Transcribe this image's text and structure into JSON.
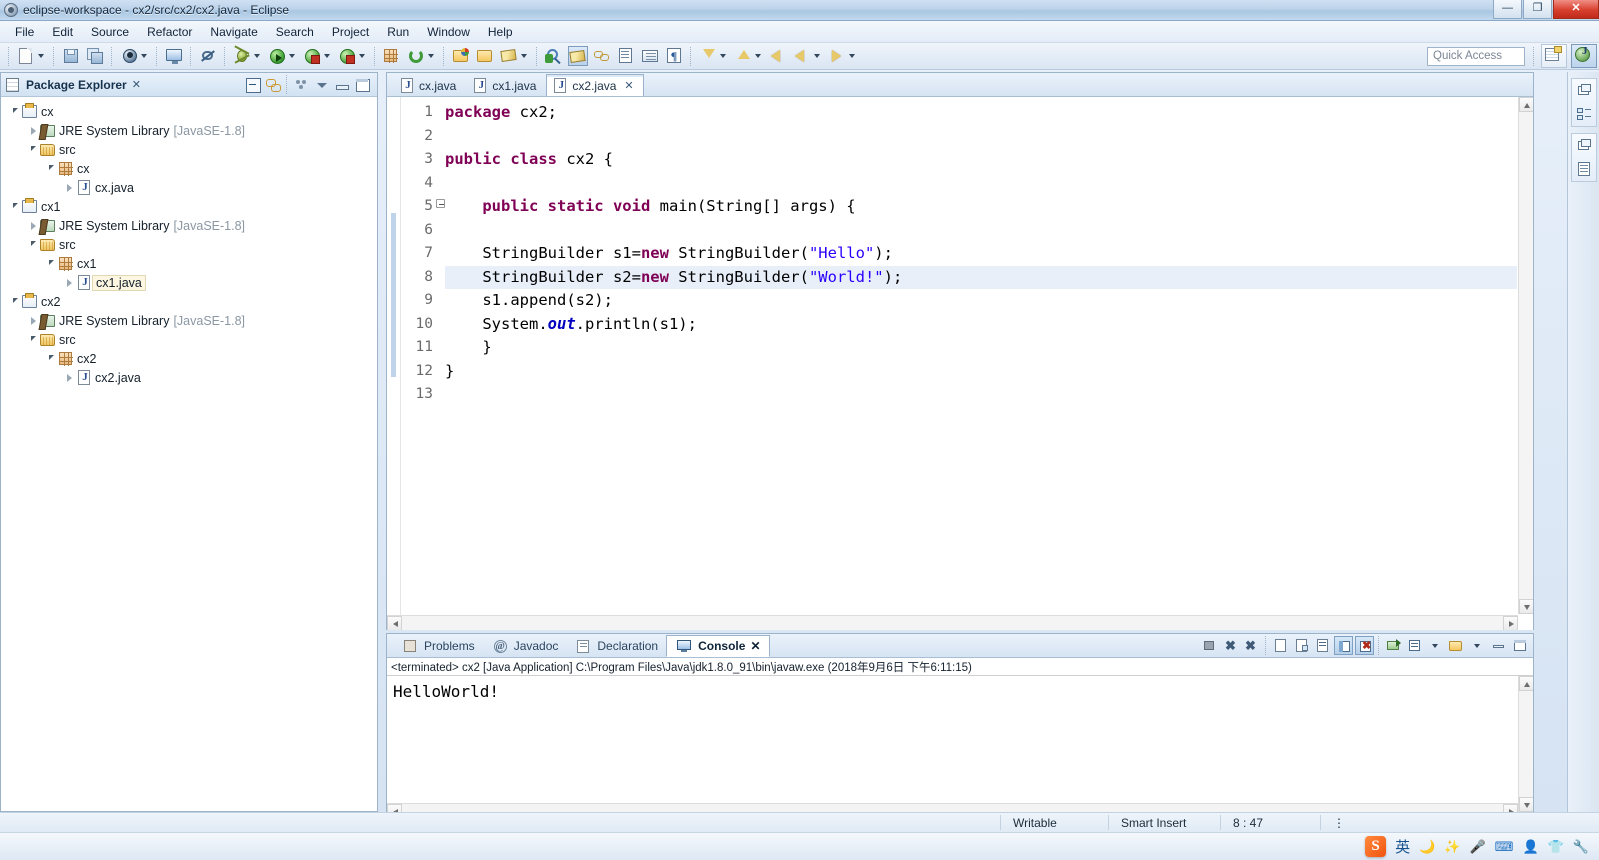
{
  "window": {
    "title": "eclipse-workspace - cx2/src/cx2/cx2.java - Eclipse",
    "minimize": "—",
    "maximize": "❐",
    "close": "✕"
  },
  "menubar": {
    "items": [
      "File",
      "Edit",
      "Source",
      "Refactor",
      "Navigate",
      "Search",
      "Project",
      "Run",
      "Window",
      "Help"
    ]
  },
  "toolbar": {
    "quick_access_placeholder": "Quick Access",
    "icons": [
      "new-wizard-icon",
      "new-dropdown-icon",
      "save-icon",
      "save-all-icon",
      "new-java-class-icon",
      "new-java-class-dropdown-icon",
      "open-type-icon",
      "skip-breakpoints-icon",
      "debug-icon",
      "debug-dropdown-icon",
      "run-icon",
      "run-dropdown-icon",
      "run-coverage-icon",
      "run-coverage-dropdown-icon",
      "external-tools-icon",
      "external-tools-dropdown-icon",
      "new-package-icon",
      "refresh-icon",
      "refresh-dropdown-icon",
      "open-perspective-icon",
      "search-icon",
      "annotations-icon",
      "pencil-icon",
      "pencil-dropdown-icon",
      "java-search-icon",
      "toggle-mark-occurrences-icon",
      "link-icon",
      "next-annotation-icon",
      "show-whitespace-icon",
      "pilcrow-icon",
      "previous-edit-icon",
      "previous-edit-dropdown-icon",
      "next-edit-icon",
      "next-edit-dropdown-icon",
      "back-icon",
      "forward-icon",
      "forward-dropdown-icon",
      "next-icon"
    ],
    "perspective_buttons": [
      "open-perspective-icon",
      "java-perspective-icon"
    ]
  },
  "explorer": {
    "title": "Package Explorer",
    "close_glyph": "✕",
    "tools": [
      "collapse-all-icon",
      "link-with-editor-icon",
      "view-menu-icon",
      "minimize-icon",
      "maximize-icon"
    ],
    "tree": [
      {
        "label": "cx",
        "icon": "project-icon",
        "indent": 0,
        "twist": "open",
        "dim": ""
      },
      {
        "label": "JRE System Library",
        "icon": "jre-library-icon",
        "indent": 1,
        "twist": "closed",
        "dim": "[JavaSE-1.8]"
      },
      {
        "label": "src",
        "icon": "source-folder-icon",
        "indent": 1,
        "twist": "open",
        "dim": ""
      },
      {
        "label": "cx",
        "icon": "package-icon",
        "indent": 2,
        "twist": "open",
        "dim": ""
      },
      {
        "label": "cx.java",
        "icon": "java-file-icon",
        "indent": 3,
        "twist": "closed",
        "dim": ""
      },
      {
        "label": "cx1",
        "icon": "project-icon",
        "indent": 0,
        "twist": "open",
        "dim": ""
      },
      {
        "label": "JRE System Library",
        "icon": "jre-library-icon",
        "indent": 1,
        "twist": "closed",
        "dim": "[JavaSE-1.8]"
      },
      {
        "label": "src",
        "icon": "source-folder-icon",
        "indent": 1,
        "twist": "open",
        "dim": ""
      },
      {
        "label": "cx1",
        "icon": "package-icon",
        "indent": 2,
        "twist": "open",
        "dim": ""
      },
      {
        "label": "cx1.java",
        "icon": "java-file-icon",
        "indent": 3,
        "twist": "closed",
        "dim": "",
        "selected": true
      },
      {
        "label": "cx2",
        "icon": "project-icon",
        "indent": 0,
        "twist": "open",
        "dim": ""
      },
      {
        "label": "JRE System Library",
        "icon": "jre-library-icon",
        "indent": 1,
        "twist": "closed",
        "dim": "[JavaSE-1.8]"
      },
      {
        "label": "src",
        "icon": "source-folder-icon",
        "indent": 1,
        "twist": "open",
        "dim": ""
      },
      {
        "label": "cx2",
        "icon": "package-icon",
        "indent": 2,
        "twist": "open",
        "dim": ""
      },
      {
        "label": "cx2.java",
        "icon": "java-file-icon",
        "indent": 3,
        "twist": "closed",
        "dim": ""
      }
    ]
  },
  "editor": {
    "tabs": [
      {
        "label": "cx.java",
        "active": false,
        "close": ""
      },
      {
        "label": "cx1.java",
        "active": false,
        "close": ""
      },
      {
        "label": "cx2.java",
        "active": true,
        "close": "✕"
      }
    ],
    "line_numbers": [
      "1",
      "2",
      "3",
      "4",
      "5",
      "6",
      "7",
      "8",
      "9",
      "10",
      "11",
      "12",
      "13"
    ],
    "highlighted_line": 8,
    "fold_line": 5,
    "lines": [
      [
        {
          "t": "package",
          "c": "kw"
        },
        {
          "t": " cx2;",
          "c": ""
        }
      ],
      [
        {
          "t": "",
          "c": ""
        }
      ],
      [
        {
          "t": "public class",
          "c": "kw"
        },
        {
          "t": " cx2 {",
          "c": ""
        }
      ],
      [
        {
          "t": "",
          "c": ""
        }
      ],
      [
        {
          "t": "    ",
          "c": ""
        },
        {
          "t": "public static void",
          "c": "kw"
        },
        {
          "t": " main(String[] args) {",
          "c": ""
        }
      ],
      [
        {
          "t": "",
          "c": ""
        }
      ],
      [
        {
          "t": "    StringBuilder s1=",
          "c": ""
        },
        {
          "t": "new",
          "c": "kw"
        },
        {
          "t": " StringBuilder(",
          "c": ""
        },
        {
          "t": "\"Hello\"",
          "c": "str"
        },
        {
          "t": ");",
          "c": ""
        }
      ],
      [
        {
          "t": "    StringBuilder s2=",
          "c": ""
        },
        {
          "t": "new",
          "c": "kw"
        },
        {
          "t": " StringBuilder(",
          "c": ""
        },
        {
          "t": "\"World!\"",
          "c": "str"
        },
        {
          "t": ");",
          "c": ""
        }
      ],
      [
        {
          "t": "    s1.append(s2);",
          "c": ""
        }
      ],
      [
        {
          "t": "    System.",
          "c": ""
        },
        {
          "t": "out",
          "c": "sfield"
        },
        {
          "t": ".println(s1);",
          "c": ""
        }
      ],
      [
        {
          "t": "    }",
          "c": ""
        }
      ],
      [
        {
          "t": "}",
          "c": ""
        }
      ],
      [
        {
          "t": "",
          "c": ""
        }
      ]
    ]
  },
  "console": {
    "tabs": [
      {
        "label": "Problems",
        "icon": "problems-icon",
        "active": false,
        "close": ""
      },
      {
        "label": "Javadoc",
        "icon": "javadoc-icon",
        "active": false,
        "close": ""
      },
      {
        "label": "Declaration",
        "icon": "declaration-icon",
        "active": false,
        "close": ""
      },
      {
        "label": "Console",
        "icon": "console-icon",
        "active": true,
        "close": "✕"
      }
    ],
    "tools": [
      "terminate-icon",
      "remove-launch-icon",
      "remove-all-terminated-icon",
      "clear-console-icon",
      "scroll-lock-icon",
      "word-wrap-icon",
      "show-console-on-output-icon",
      "pin-console-icon",
      "display-selected-console-icon",
      "open-console-icon",
      "open-console-dropdown-icon",
      "view-menu-icon",
      "minimize-icon",
      "maximize-icon"
    ],
    "status_line": "<terminated> cx2 [Java Application] C:\\Program Files\\Java\\jdk1.8.0_91\\bin\\javaw.exe (2018年9月6日 下午6:11:15)",
    "output": "HelloWorld!"
  },
  "statusbar": {
    "writable": "Writable",
    "insert_mode": "Smart Insert",
    "cursor_position": "8 : 47"
  },
  "taskbar": {
    "ime": {
      "logo": "S",
      "mode": "英",
      "icons": [
        "moon-icon",
        "sparkle-icon",
        "microphone-icon",
        "keyboard-icon",
        "user-icon",
        "skin-icon",
        "tools-icon"
      ]
    }
  },
  "rightbar": {
    "groups": [
      [
        "restore-icon",
        "package-explorer-icon"
      ],
      [
        "restore-icon",
        "outline-icon"
      ]
    ]
  },
  "colors": {
    "keyword": "#7f0055",
    "string": "#2a00ff",
    "static_field": "#0000c0",
    "line_highlight": "#e8eff9",
    "selection": "#fdf7e2",
    "title_bar": "#bcd3ea",
    "close_button": "#d8402f"
  }
}
